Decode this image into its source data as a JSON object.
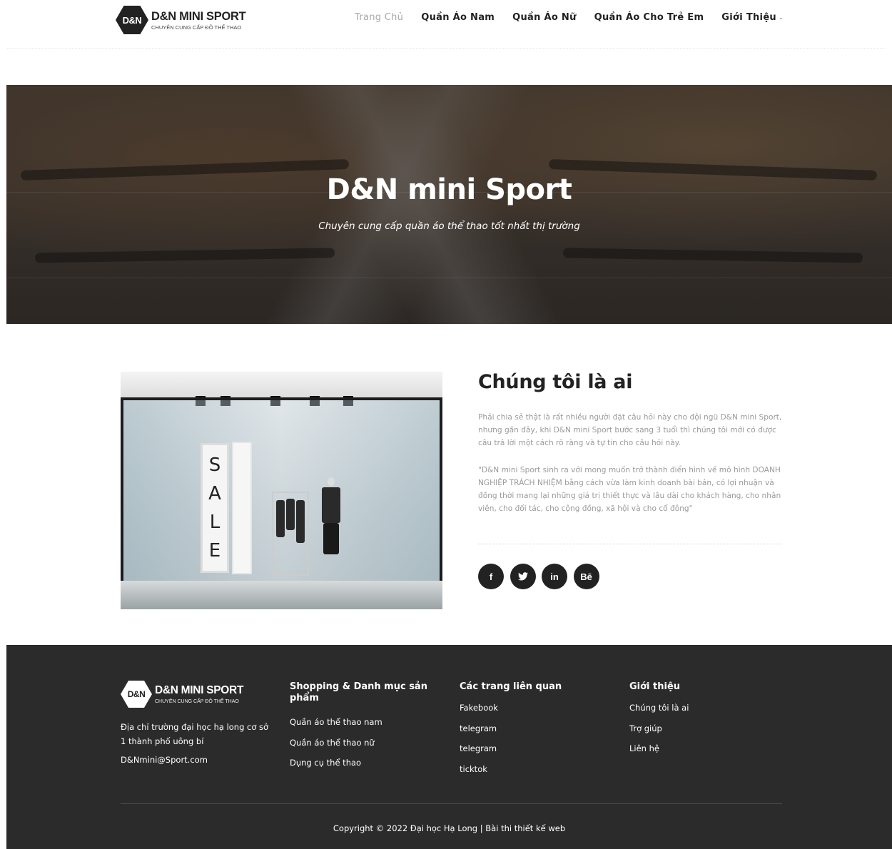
{
  "brand": {
    "logo_mark": "D&N",
    "name": "D&N MINI SPORT",
    "tagline": "CHUYÊN CUNG CẤP ĐỒ THỂ THAO"
  },
  "nav": {
    "items": [
      {
        "label": "Trang Chủ",
        "active": true
      },
      {
        "label": "Quần Áo Nam"
      },
      {
        "label": "Quần Áo Nữ"
      },
      {
        "label": "Quần Áo Cho Trẻ Em"
      },
      {
        "label": "Giới Thiệu",
        "dropdown": true
      }
    ],
    "dropdown_glyph": "⌄"
  },
  "hero": {
    "title": "D&N mini Sport",
    "subtitle": "Chuyên cung cấp quần áo thể thao tốt nhất thị trường"
  },
  "about": {
    "sale_letters": [
      "S",
      "A",
      "L",
      "E"
    ],
    "title": "Chúng tôi là ai",
    "paragraph1": "Phải chia sẻ thật là rất nhiều người đặt câu hỏi này cho đội ngũ D&N mini Sport, nhưng gần đây, khi D&N mini Sport bước sang 3 tuổi thì chúng tôi mới có được câu trả lời một cách rõ ràng và tự tin cho câu hỏi này.",
    "paragraph2": "\"D&N mini Sport sinh ra với mong muốn trở thành điển hình về mô hình DOANH NGHIỆP TRÁCH NHIỆM bằng cách vừa làm kinh doanh bài bản, có lợi nhuận và đồng thời mang lại những giá trị thiết thực và lâu dài cho khách hàng, cho nhân viên, cho đối tác, cho cộng đồng, xã hội và cho cổ đông\"",
    "socials": [
      {
        "icon": "facebook-icon",
        "glyph": "f"
      },
      {
        "icon": "twitter-icon",
        "glyph": "🐦"
      },
      {
        "icon": "linkedin-icon",
        "glyph": "in"
      },
      {
        "icon": "behance-icon",
        "glyph": "Bē"
      }
    ]
  },
  "footer": {
    "address": "Địa chỉ trường đại học hạ long cơ sở 1 thành phố uông bí",
    "email": "D&Nmini@Sport.com",
    "col1": {
      "title": "Shopping & Danh mục sản phẩm",
      "links": [
        "Quần áo thể thao nam",
        "Quần áo thể thao nữ",
        "Dụng cụ thể thao"
      ]
    },
    "col2": {
      "title": "Các trang liên quan",
      "links": [
        "Fakebook",
        "telegram",
        "telegram",
        "ticktok"
      ]
    },
    "col3": {
      "title": "Giới thiệu",
      "links": [
        "Chúng tôi là ai",
        "Trợ giúp",
        "Liên hệ"
      ]
    },
    "copyright": "Copyright © 2022 Đại học Hạ Long | Bài thi thiết kế web"
  },
  "colors": {
    "dark": "#222222",
    "footer_bg": "#2b2b2b",
    "muted_text": "#9a9a9a",
    "nav_active": "#a8a8a8"
  }
}
